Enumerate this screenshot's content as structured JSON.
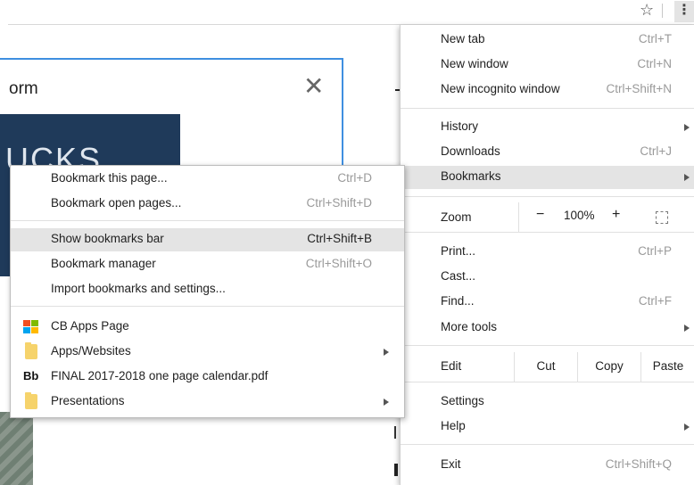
{
  "dialog": {
    "title": "orm",
    "close_glyph": "✕"
  },
  "banner": {
    "text": "UCKS"
  },
  "browser": {
    "star_glyph": "☆",
    "menu_glyph": "⋮"
  },
  "main_menu": {
    "new_tab": {
      "label": "New tab",
      "shortcut": "Ctrl+T"
    },
    "new_window": {
      "label": "New window",
      "shortcut": "Ctrl+N"
    },
    "new_incognito": {
      "label": "New incognito window",
      "shortcut": "Ctrl+Shift+N"
    },
    "history": {
      "label": "History"
    },
    "downloads": {
      "label": "Downloads",
      "shortcut": "Ctrl+J"
    },
    "bookmarks": {
      "label": "Bookmarks"
    },
    "zoom": {
      "label": "Zoom",
      "minus": "−",
      "value": "100%",
      "plus": "+"
    },
    "print": {
      "label": "Print...",
      "shortcut": "Ctrl+P"
    },
    "cast": {
      "label": "Cast..."
    },
    "find": {
      "label": "Find...",
      "shortcut": "Ctrl+F"
    },
    "more_tools": {
      "label": "More tools"
    },
    "edit": {
      "label": "Edit",
      "cut": "Cut",
      "copy": "Copy",
      "paste": "Paste"
    },
    "settings": {
      "label": "Settings"
    },
    "help": {
      "label": "Help"
    },
    "exit": {
      "label": "Exit",
      "shortcut": "Ctrl+Shift+Q"
    }
  },
  "bookmarks_menu": {
    "bookmark_page": {
      "label": "Bookmark this page...",
      "shortcut": "Ctrl+D"
    },
    "bookmark_open": {
      "label": "Bookmark open pages...",
      "shortcut": "Ctrl+Shift+D"
    },
    "show_bar": {
      "label": "Show bookmarks bar",
      "shortcut": "Ctrl+Shift+B"
    },
    "manager": {
      "label": "Bookmark manager",
      "shortcut": "Ctrl+Shift+O"
    },
    "import": {
      "label": "Import bookmarks and settings..."
    },
    "items": [
      {
        "label": "CB Apps Page",
        "icon": "microsoft-logo-icon"
      },
      {
        "label": "Apps/Websites",
        "icon": "folder-icon"
      },
      {
        "label": "FINAL 2017-2018 one page calendar.pdf",
        "icon": "blackboard-icon",
        "icon_text": "Bb"
      },
      {
        "label": "Presentations",
        "icon": "folder-icon"
      }
    ]
  },
  "colors": {
    "highlight": "#e4e4e4",
    "accent": "#3f8fe0",
    "folder": "#f6d36b"
  }
}
